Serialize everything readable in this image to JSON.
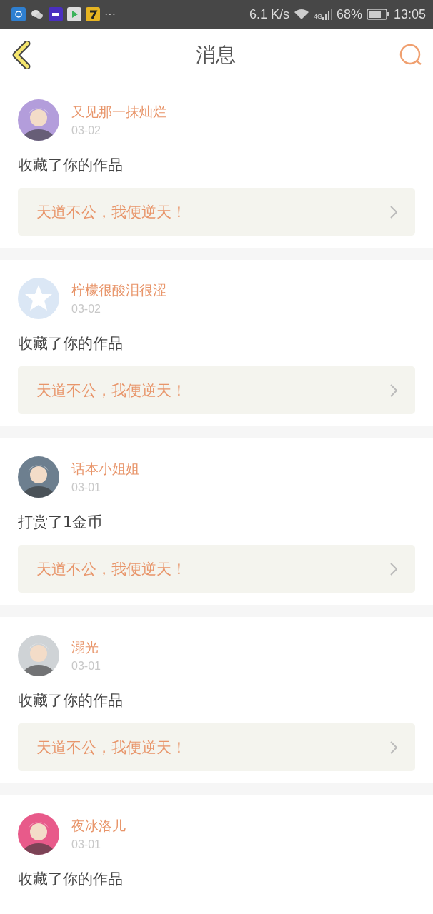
{
  "status_bar": {
    "more": "···",
    "speed": "6.1 K/s",
    "network": "4G",
    "battery": "68%",
    "time": "13:05"
  },
  "header": {
    "title": "消息"
  },
  "messages": [
    {
      "user": "又见那一抹灿烂",
      "date": "03-02",
      "action": "收藏了你的作品",
      "work": "天道不公，我便逆天！"
    },
    {
      "user": "柠檬很酸泪很涩",
      "date": "03-02",
      "avatar": {
        "kind": "default",
        "color": "#dbe7f5"
      },
      "action": "收藏了你的作品",
      "work": "天道不公，我便逆天！"
    },
    {
      "user": "话本小姐姐",
      "date": "03-01",
      "action": "打赏了1金币",
      "work": "天道不公，我便逆天！"
    },
    {
      "user": "溺光",
      "date": "03-01",
      "action": "收藏了你的作品",
      "work": "天道不公，我便逆天！"
    },
    {
      "user": "夜冰洛儿",
      "date": "03-01",
      "action": "收藏了你的作品"
    }
  ]
}
